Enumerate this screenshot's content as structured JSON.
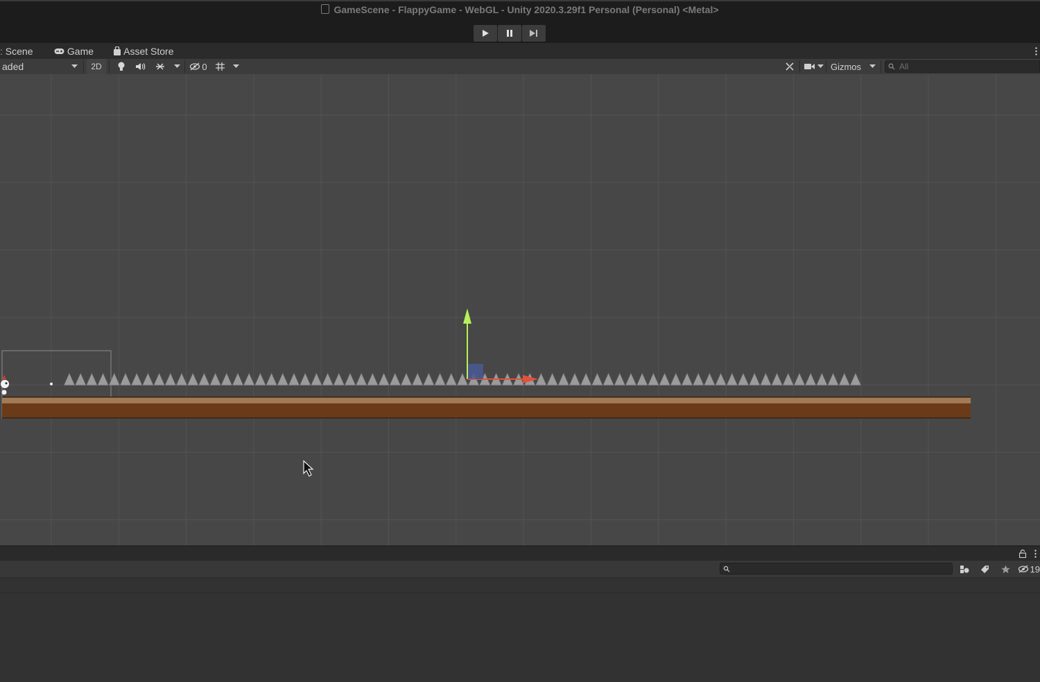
{
  "window": {
    "title": "GameScene - FlappyGame - WebGL - Unity 2020.3.29f1 Personal (Personal) <Metal>"
  },
  "play_controls": {
    "play": "play-icon",
    "pause": "pause-icon",
    "step": "step-icon"
  },
  "tabs": [
    {
      "label": "Scene",
      "icon": "scene-icon"
    },
    {
      "label": "Game",
      "icon": "gamepad-icon"
    },
    {
      "label": "Asset Store",
      "icon": "shopping-bag-icon"
    }
  ],
  "scene_toolbar": {
    "draw_mode": "aded",
    "mode_2d": "2D",
    "hidden_count": "0",
    "gizmos": "Gizmos",
    "search_placeholder": "All"
  },
  "bottom_panel": {
    "hidden_count": "19"
  },
  "colors": {
    "scene_bg": "#474747",
    "ground_top": "#a27b55",
    "ground_fill": "#6b3a19",
    "move_y_axis": "#b6f05a",
    "move_x_axis": "#e0533a",
    "spike": "#9b9b9b"
  }
}
